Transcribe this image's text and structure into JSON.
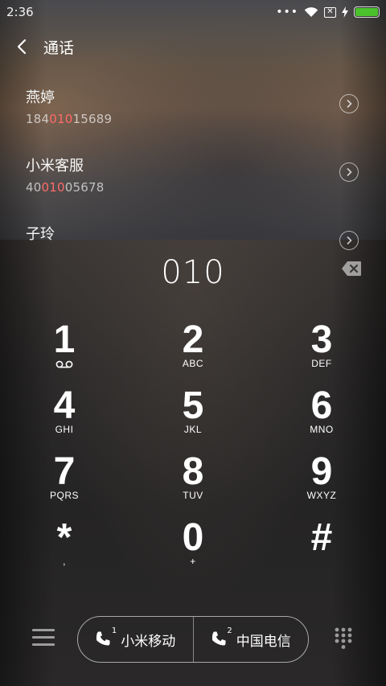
{
  "status": {
    "time": "2:36",
    "dots": "•••",
    "box_x": "✕"
  },
  "header": {
    "title": "通话"
  },
  "contacts": [
    {
      "name": "燕婷",
      "number_pre": "184",
      "number_hl": "010",
      "number_post": "15689"
    },
    {
      "name": "小米客服",
      "number_pre": "40",
      "number_hl": "010",
      "number_post": "05678"
    },
    {
      "name": "子玲",
      "number_pre": "",
      "number_hl": "",
      "number_post": ""
    }
  ],
  "dial": {
    "display": "010"
  },
  "keys": [
    {
      "digit": "1",
      "letters": ""
    },
    {
      "digit": "2",
      "letters": "ABC"
    },
    {
      "digit": "3",
      "letters": "DEF"
    },
    {
      "digit": "4",
      "letters": "GHI"
    },
    {
      "digit": "5",
      "letters": "JKL"
    },
    {
      "digit": "6",
      "letters": "MNO"
    },
    {
      "digit": "7",
      "letters": "PQRS"
    },
    {
      "digit": "8",
      "letters": "TUV"
    },
    {
      "digit": "9",
      "letters": "WXYZ"
    },
    {
      "digit": "*",
      "letters": ","
    },
    {
      "digit": "0",
      "letters": "+"
    },
    {
      "digit": "#",
      "letters": ""
    }
  ],
  "sim_buttons": [
    {
      "sim_number": "1",
      "label": "小米移动"
    },
    {
      "sim_number": "2",
      "label": "中国电信"
    }
  ],
  "colors": {
    "highlight": "#ff6a6a",
    "battery": "#4bc22c"
  }
}
